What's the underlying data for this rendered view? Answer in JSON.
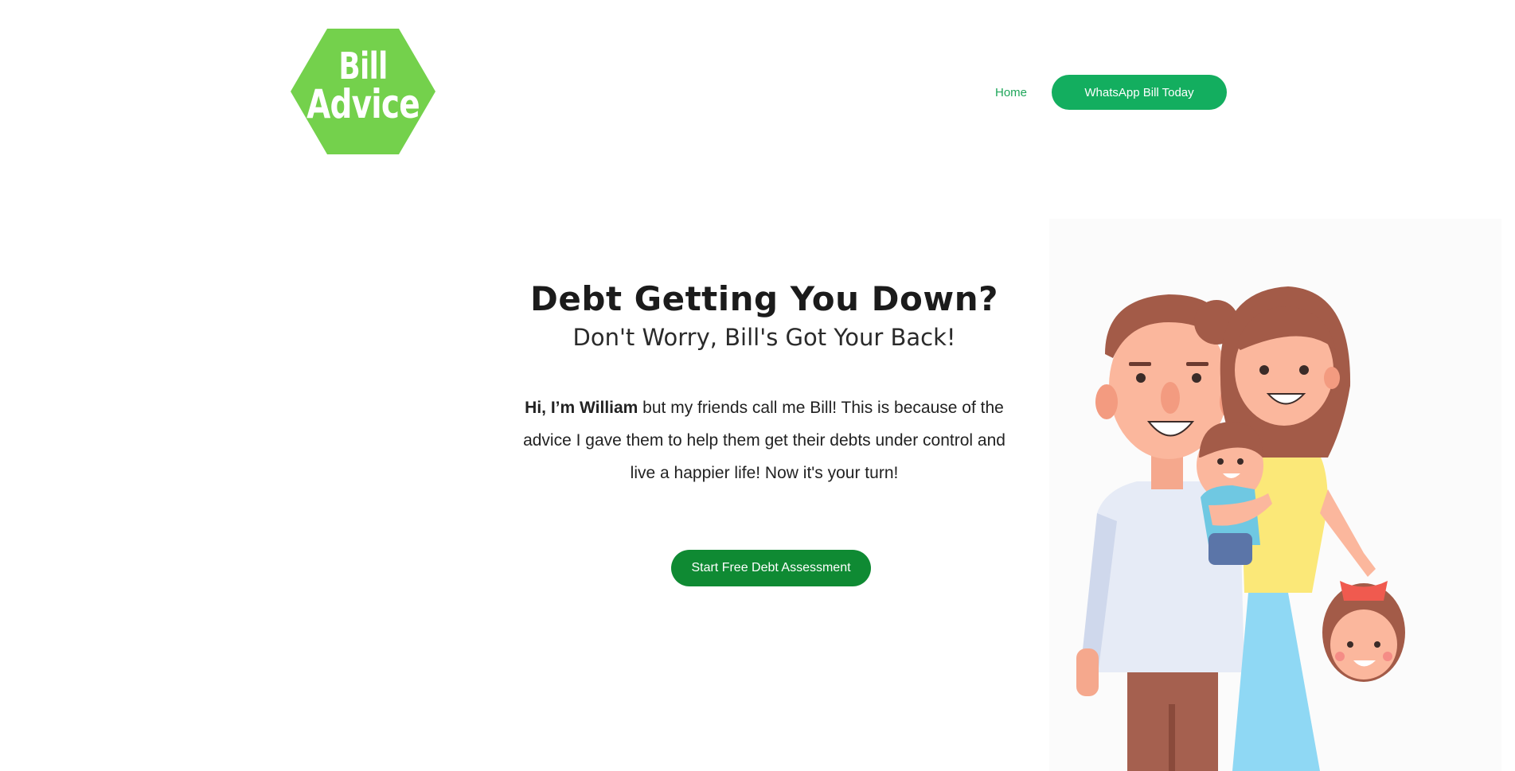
{
  "header": {
    "logo": {
      "line1": "Bill",
      "line2": "Advice",
      "color": "#74d14c"
    },
    "nav": {
      "home_label": "Home",
      "cta_label": "WhatsApp Bill Today"
    }
  },
  "hero": {
    "title": "Debt Getting You Down?",
    "subtitle": "Don't Worry, Bill's Got Your Back!",
    "intro_bold": "Hi, I’m William",
    "intro_rest": " but my friends call me Bill! This is because of the advice I gave them to help them get their debts under control and live a happier life! Now it's your turn!",
    "cta_label": "Start Free Debt Assessment"
  },
  "colors": {
    "accent_green": "#13ae5f",
    "cta_dark_green": "#0f8a33",
    "logo_green": "#74d14c"
  },
  "illustration": {
    "icon": "family-illustration"
  }
}
